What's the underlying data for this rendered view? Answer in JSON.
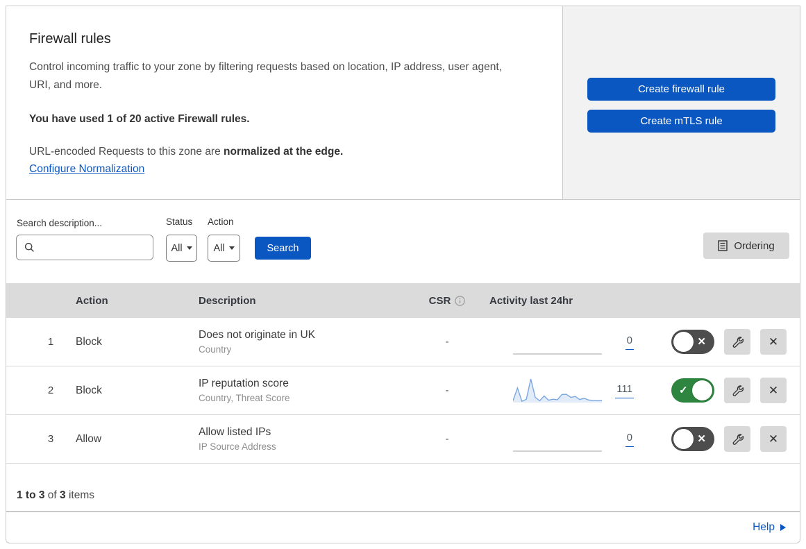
{
  "header": {
    "title": "Firewall rules",
    "description": "Control incoming traffic to your zone by filtering requests based on location, IP address, user agent, URI, and more.",
    "usage_bold": "You have used 1 of 20 active Firewall rules.",
    "normalization_prefix": "URL-encoded Requests to this zone are ",
    "normalization_bold": "normalized at the edge.",
    "configure_link": "Configure Normalization",
    "buttons": [
      {
        "label": "Create firewall rule"
      },
      {
        "label": "Create mTLS rule"
      }
    ]
  },
  "filters": {
    "search_label": "Search description...",
    "search_value": "",
    "status_label": "Status",
    "status_value": "All",
    "action_label": "Action",
    "action_value": "All",
    "search_button": "Search",
    "ordering_button": "Ordering"
  },
  "table": {
    "columns": {
      "action": "Action",
      "description": "Description",
      "csr": "CSR",
      "activity": "Activity last 24hr"
    },
    "rows": [
      {
        "index": "1",
        "action": "Block",
        "title": "Does not originate in UK",
        "subtitle": "Country",
        "csr": "-",
        "count": "0",
        "enabled": false,
        "sparkline": []
      },
      {
        "index": "2",
        "action": "Block",
        "title": "IP reputation score",
        "subtitle": "Country, Threat Score",
        "csr": "-",
        "count": "111",
        "enabled": true,
        "sparkline": [
          8,
          62,
          5,
          14,
          100,
          22,
          8,
          28,
          10,
          14,
          12,
          34,
          35,
          22,
          26,
          13,
          18,
          11,
          9,
          8,
          9
        ]
      },
      {
        "index": "3",
        "action": "Allow",
        "title": "Allow listed IPs",
        "subtitle": "IP Source Address",
        "csr": "-",
        "count": "0",
        "enabled": false,
        "sparkline": []
      }
    ],
    "footer": {
      "range_bold": "1 to 3",
      "of_text": " of ",
      "total_bold": "3",
      "items_text": " items"
    }
  },
  "bottom_bar": {
    "help_label": "Help"
  },
  "colors": {
    "accent_blue": "#0b57c2",
    "toggle_on_green": "#2e8540",
    "toggle_off_gray": "#4d4d4d",
    "aside_panel_gray": "#f2f2f2",
    "table_header_gray": "#dbdbdb",
    "sparkline_blue": "#7aa7e0"
  }
}
